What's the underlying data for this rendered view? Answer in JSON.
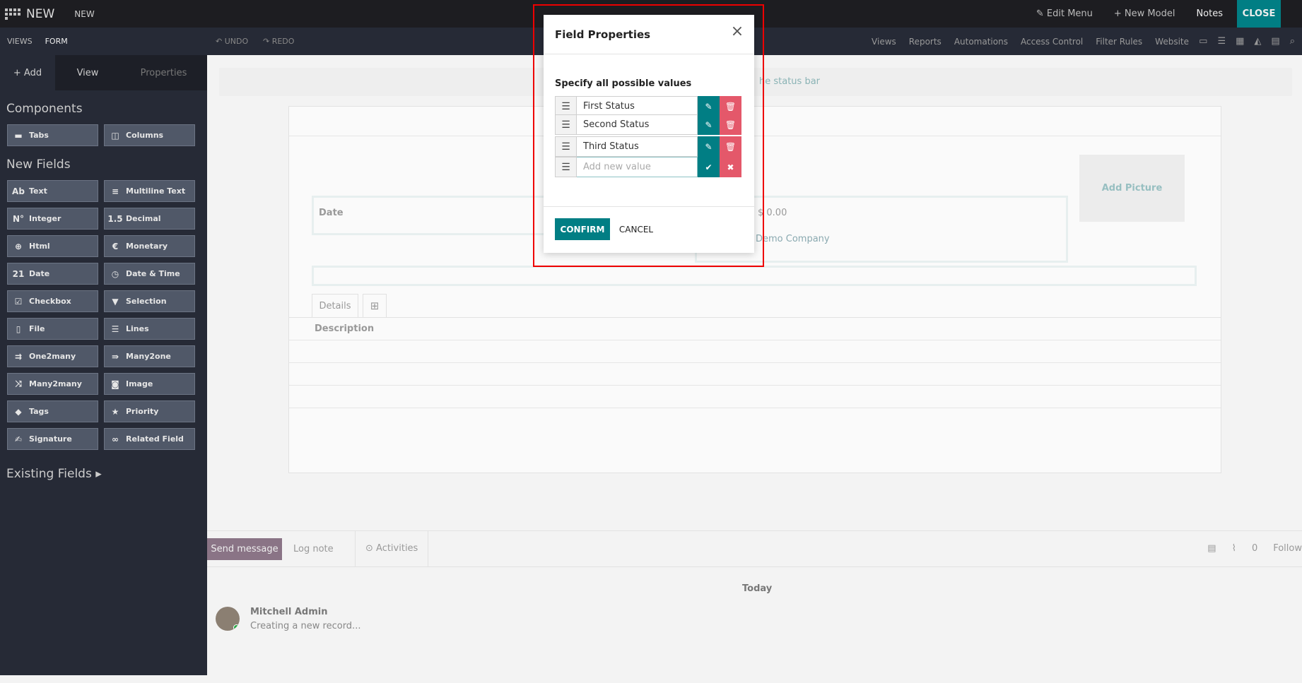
{
  "topbar": {
    "title": "NEW",
    "crumb": "NEW",
    "edit_menu": "✎ Edit Menu",
    "new_model": "+ New Model",
    "notes": "Notes",
    "close": "CLOSE"
  },
  "subbar": {
    "views": "VIEWS",
    "form": "FORM",
    "undo": "↶ UNDO",
    "redo": "↷ REDO",
    "menu": [
      "Views",
      "Reports",
      "Automations",
      "Access Control",
      "Filter Rules",
      "Website"
    ]
  },
  "sidebar": {
    "tab_add": "+ Add",
    "tab_view": "View",
    "tab_properties": "Properties",
    "components_heading": "Components",
    "components": [
      {
        "label": "Tabs",
        "icon": "▬"
      },
      {
        "label": "Columns",
        "icon": "◫"
      }
    ],
    "new_fields_heading": "New Fields",
    "fields": [
      {
        "label": "Text",
        "icon": "Ab"
      },
      {
        "label": "Multiline Text",
        "icon": "≡"
      },
      {
        "label": "Integer",
        "icon": "N°"
      },
      {
        "label": "Decimal",
        "icon": "1.5"
      },
      {
        "label": "Html",
        "icon": "⊕"
      },
      {
        "label": "Monetary",
        "icon": "€"
      },
      {
        "label": "Date",
        "icon": "21"
      },
      {
        "label": "Date & Time",
        "icon": "◷"
      },
      {
        "label": "Checkbox",
        "icon": "☑"
      },
      {
        "label": "Selection",
        "icon": "▼"
      },
      {
        "label": "File",
        "icon": "▯"
      },
      {
        "label": "Lines",
        "icon": "☰"
      },
      {
        "label": "One2many",
        "icon": "⇉"
      },
      {
        "label": "Many2one",
        "icon": "⇛"
      },
      {
        "label": "Many2many",
        "icon": "⤨"
      },
      {
        "label": "Image",
        "icon": "◙"
      },
      {
        "label": "Tags",
        "icon": "◆"
      },
      {
        "label": "Priority",
        "icon": "★"
      },
      {
        "label": "Signature",
        "icon": "✍"
      },
      {
        "label": "Related Field",
        "icon": "∞"
      }
    ],
    "existing_fields": "Existing Fields ▸"
  },
  "main": {
    "statusbar_hint": "he status bar",
    "add_picture": "Add Picture",
    "date_label": "Date",
    "amount": "$ 0.00",
    "company": "Demo Company",
    "tab_details": "Details",
    "tab_plus": "⊞",
    "description": "Description"
  },
  "chatter": {
    "send_message": "Send message",
    "log_note": "Log note",
    "activities": "⊙ Activities",
    "followers_count": "0",
    "follow": "Follow",
    "today": "Today",
    "author": "Mitchell Admin",
    "message": "Creating a new record..."
  },
  "dialog": {
    "title": "Field Properties",
    "close_icon": "×",
    "heading": "Specify all possible values",
    "values": [
      "First Status",
      "Second Status",
      "Third Status"
    ],
    "new_value_placeholder": "Add new value",
    "confirm": "CONFIRM",
    "cancel": "CANCEL"
  },
  "colors": {
    "accent": "#017e84",
    "danger": "#e4586a",
    "highlight": "#ee0000"
  }
}
